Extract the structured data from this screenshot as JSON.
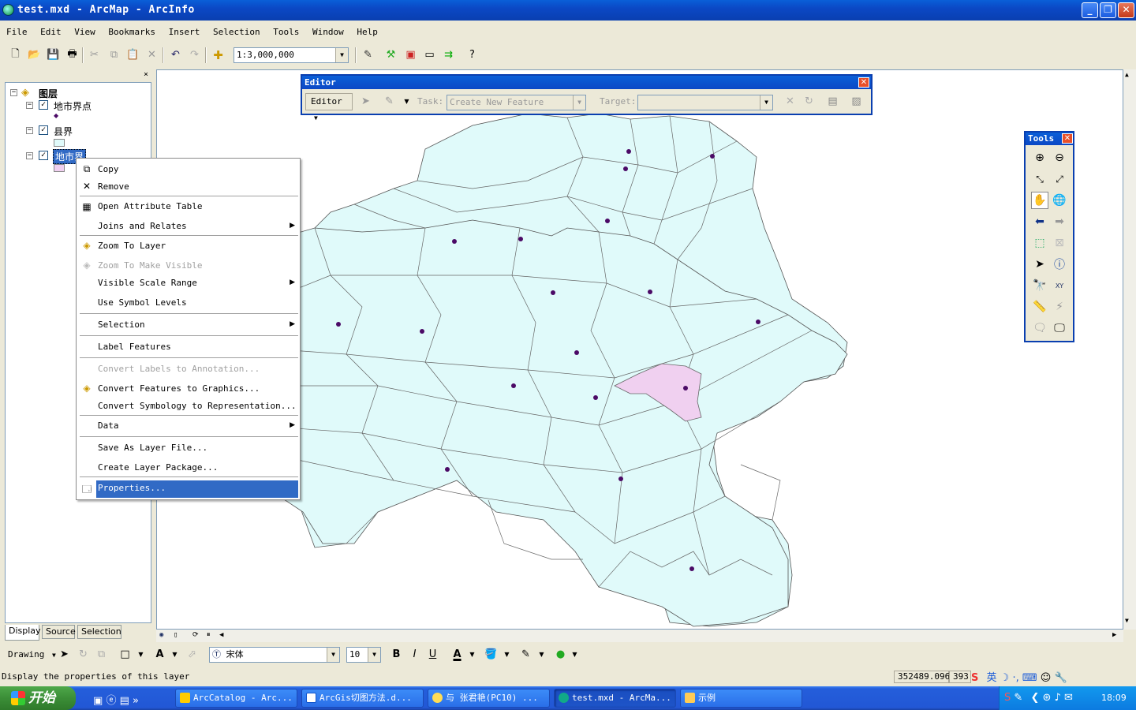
{
  "window": {
    "title": "test.mxd - ArcMap - ArcInfo",
    "minimize": "_",
    "restore": "❐",
    "close": "✕"
  },
  "menu": [
    {
      "label": "File"
    },
    {
      "label": "Edit"
    },
    {
      "label": "View"
    },
    {
      "label": "Bookmarks"
    },
    {
      "label": "Insert"
    },
    {
      "label": "Selection"
    },
    {
      "label": "Tools"
    },
    {
      "label": "Window"
    },
    {
      "label": "Help"
    }
  ],
  "toolbar": {
    "scale": "1:3,000,000"
  },
  "toc": {
    "root": "图层",
    "layers": [
      {
        "name": "地市界点",
        "checked": "✓"
      },
      {
        "name": "县界",
        "checked": "✓"
      },
      {
        "name": "地市界",
        "checked": "✓"
      }
    ],
    "close": "×",
    "tabs": [
      "Display",
      "Source",
      "Selection"
    ]
  },
  "context_menu": {
    "items": [
      {
        "label": "Copy"
      },
      {
        "label": "Remove"
      },
      {
        "label": "Open Attribute Table"
      },
      {
        "label": "Joins and Relates"
      },
      {
        "label": "Zoom To Layer"
      },
      {
        "label": "Zoom To Make Visible"
      },
      {
        "label": "Visible Scale Range"
      },
      {
        "label": "Use Symbol Levels"
      },
      {
        "label": "Selection"
      },
      {
        "label": "Label Features"
      },
      {
        "label": "Convert Labels to Annotation..."
      },
      {
        "label": "Convert Features to Graphics..."
      },
      {
        "label": "Convert Symbology to Representation..."
      },
      {
        "label": "Data"
      },
      {
        "label": "Save As Layer File..."
      },
      {
        "label": "Create Layer Package..."
      },
      {
        "label": "Properties..."
      }
    ],
    "submenu_arrow": "▶"
  },
  "editor": {
    "title": "Editor",
    "menu_label": "Editor",
    "task_label": "Task:",
    "task_value": "Create New Feature",
    "target_label": "Target:",
    "close": "✕"
  },
  "tools": {
    "title": "Tools",
    "close": "✕",
    "xy_label": "XY"
  },
  "drawing": {
    "label": "Drawing",
    "font": "宋体",
    "size": "10",
    "bold": "B",
    "italic": "I",
    "underline": "U"
  },
  "status": {
    "message": "Display the properties of this layer",
    "x": "352489.096",
    "y": "393"
  },
  "taskbar": {
    "start": "开始",
    "tasks": [
      {
        "label": "ArcCatalog - Arc..."
      },
      {
        "label": "ArcGis切图方法.d..."
      },
      {
        "label": "与 张君艳(PC10) ..."
      },
      {
        "label": "test.mxd - ArcMa..."
      },
      {
        "label": "示例"
      }
    ],
    "ime": "英",
    "clock": "18:09"
  },
  "colors": {
    "map_fill": "#e0fafa",
    "selected_fill": "#f0d0f0",
    "highlight": "#316ac5",
    "titlebar": "#0b48c5"
  }
}
